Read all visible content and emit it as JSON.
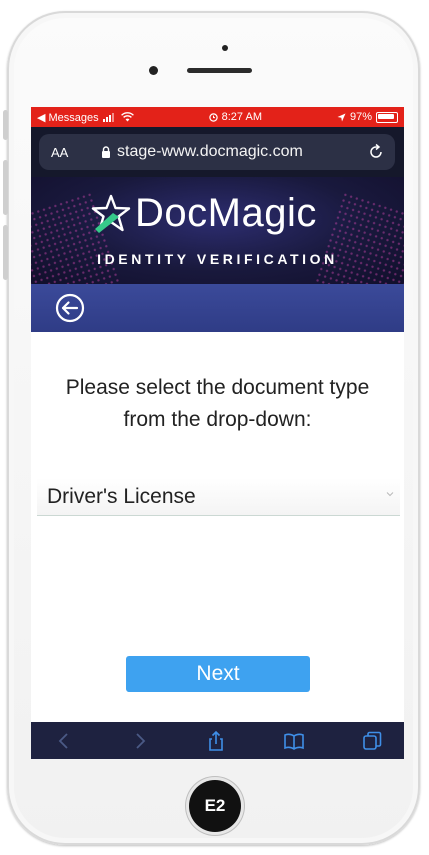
{
  "status_bar": {
    "back_app": "◀ Messages",
    "time": "8:27 AM",
    "battery": "97%"
  },
  "browser": {
    "text_size_label": "AA",
    "url": "stage-www.docmagic.com"
  },
  "banner": {
    "brand": "DocMagic",
    "tagline": "IDENTITY VERIFICATION"
  },
  "page": {
    "prompt_line1": "Please select the document type",
    "prompt_line2": "from the drop-down:",
    "document_type_selected": "Driver's License",
    "next_label": "Next"
  },
  "device": {
    "home_badge": "E2"
  },
  "colors": {
    "status_bar": "#e32219",
    "next_button": "#3ea2f0",
    "subheader": "#33418c",
    "banner_bg": "#19193d"
  },
  "icons": [
    "signal-icon",
    "wifi-icon",
    "alarm-icon",
    "location-icon",
    "battery-icon",
    "lock-icon",
    "reload-icon",
    "star-logo-icon",
    "back-arrow-icon",
    "chevron-down-icon",
    "browser-back-icon",
    "browser-forward-icon",
    "share-icon",
    "bookmarks-icon",
    "tabs-icon"
  ]
}
